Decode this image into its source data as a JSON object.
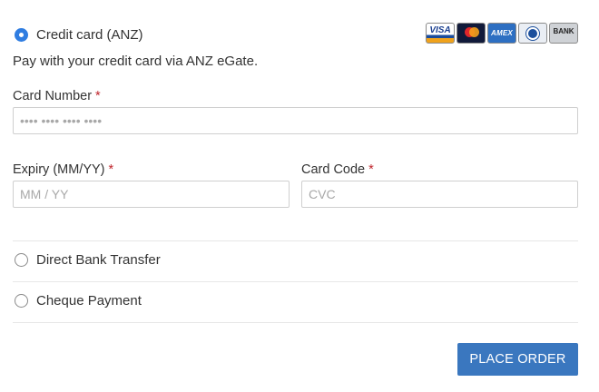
{
  "payment_methods": {
    "credit_card": {
      "label": "Credit card (ANZ)",
      "selected": true,
      "description": "Pay with your credit card via ANZ eGate.",
      "card_icons": [
        {
          "name": "visa-card-icon",
          "text": "VISA"
        },
        {
          "name": "mastercard-card-icon",
          "text": ""
        },
        {
          "name": "amex-card-icon",
          "text": "AMEX"
        },
        {
          "name": "diners-card-icon",
          "text": ""
        },
        {
          "name": "bank-card-icon",
          "text": "BANK"
        }
      ]
    },
    "direct_bank_transfer": {
      "label": "Direct Bank Transfer",
      "selected": false
    },
    "cheque_payment": {
      "label": "Cheque Payment",
      "selected": false
    }
  },
  "form": {
    "card_number": {
      "label": "Card Number",
      "required_mark": "*",
      "placeholder": "•••• •••• •••• ••••",
      "value": ""
    },
    "expiry": {
      "label": "Expiry (MM/YY)",
      "required_mark": "*",
      "placeholder": "MM / YY",
      "value": ""
    },
    "card_code": {
      "label": "Card Code",
      "required_mark": "*",
      "placeholder": "CVC",
      "value": ""
    }
  },
  "actions": {
    "place_order_label": "PLACE ORDER"
  },
  "colors": {
    "accent": "#2f7de1",
    "button": "#3a77bf",
    "required": "#c0262d"
  }
}
